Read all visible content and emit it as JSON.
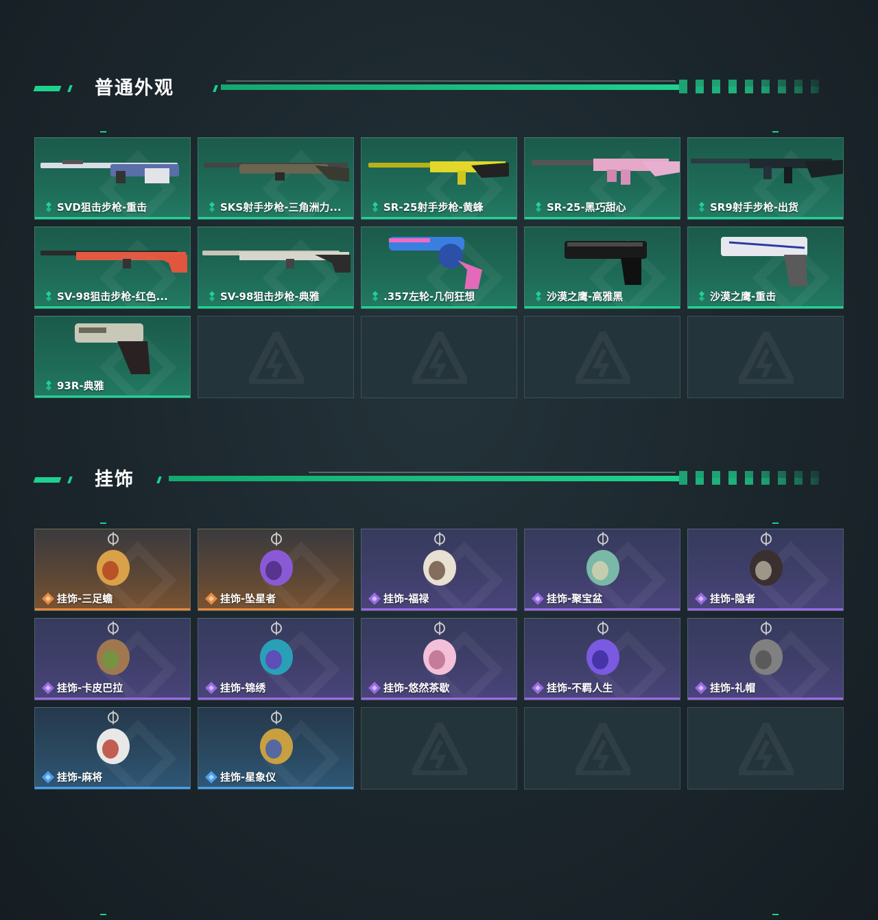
{
  "sections": [
    {
      "title": "普通外观",
      "items": [
        {
          "label": "SVD狙击步枪-重击",
          "rarity": "green",
          "icon": "sniper-rifle-icon"
        },
        {
          "label": "SKS射手步枪-三角洲力...",
          "rarity": "green",
          "icon": "marksman-rifle-icon"
        },
        {
          "label": "SR-25射手步枪-黄蜂",
          "rarity": "green",
          "icon": "marksman-rifle-icon"
        },
        {
          "label": "SR-25-黑巧甜心",
          "rarity": "green",
          "icon": "assault-rifle-icon"
        },
        {
          "label": "SR9射手步枪-出货",
          "rarity": "green",
          "icon": "marksman-rifle-icon"
        },
        {
          "label": "SV-98狙击步枪-红色...",
          "rarity": "green",
          "icon": "sniper-rifle-icon"
        },
        {
          "label": "SV-98狙击步枪-典雅",
          "rarity": "green",
          "icon": "sniper-rifle-icon"
        },
        {
          "label": ".357左轮-几何狂想",
          "rarity": "green",
          "icon": "revolver-icon"
        },
        {
          "label": "沙漠之鹰-高雅黑",
          "rarity": "green",
          "icon": "pistol-icon"
        },
        {
          "label": "沙漠之鹰-重击",
          "rarity": "green",
          "icon": "pistol-icon"
        },
        {
          "label": "93R-典雅",
          "rarity": "green",
          "icon": "pistol-icon"
        }
      ],
      "empty_slots": 4
    },
    {
      "title": "挂饰",
      "items": [
        {
          "label": "挂饰-三足蟾",
          "rarity": "orange",
          "icon": "charm-icon"
        },
        {
          "label": "挂饰-坠星者",
          "rarity": "orange",
          "icon": "charm-icon"
        },
        {
          "label": "挂饰-福禄",
          "rarity": "purple",
          "icon": "charm-icon"
        },
        {
          "label": "挂饰-聚宝盆",
          "rarity": "purple",
          "icon": "charm-icon"
        },
        {
          "label": "挂饰-隐者",
          "rarity": "purple",
          "icon": "charm-icon"
        },
        {
          "label": "挂饰-卡皮巴拉",
          "rarity": "purple",
          "icon": "charm-icon"
        },
        {
          "label": "挂饰-锦绣",
          "rarity": "purple",
          "icon": "charm-icon"
        },
        {
          "label": "挂饰-悠然茶歇",
          "rarity": "purple",
          "icon": "charm-icon"
        },
        {
          "label": "挂饰-不羁人生",
          "rarity": "purple",
          "icon": "charm-icon"
        },
        {
          "label": "挂饰-礼帽",
          "rarity": "purple",
          "icon": "charm-icon"
        },
        {
          "label": "挂饰-麻将",
          "rarity": "blue",
          "icon": "charm-icon"
        },
        {
          "label": "挂饰-星象仪",
          "rarity": "blue",
          "icon": "charm-icon"
        }
      ],
      "empty_slots": 3
    }
  ],
  "colors": {
    "accent": "#1fd18e",
    "green": "#21d393",
    "orange": "#e98a3c",
    "purple": "#9a6ae6",
    "blue": "#4a9ff0"
  }
}
